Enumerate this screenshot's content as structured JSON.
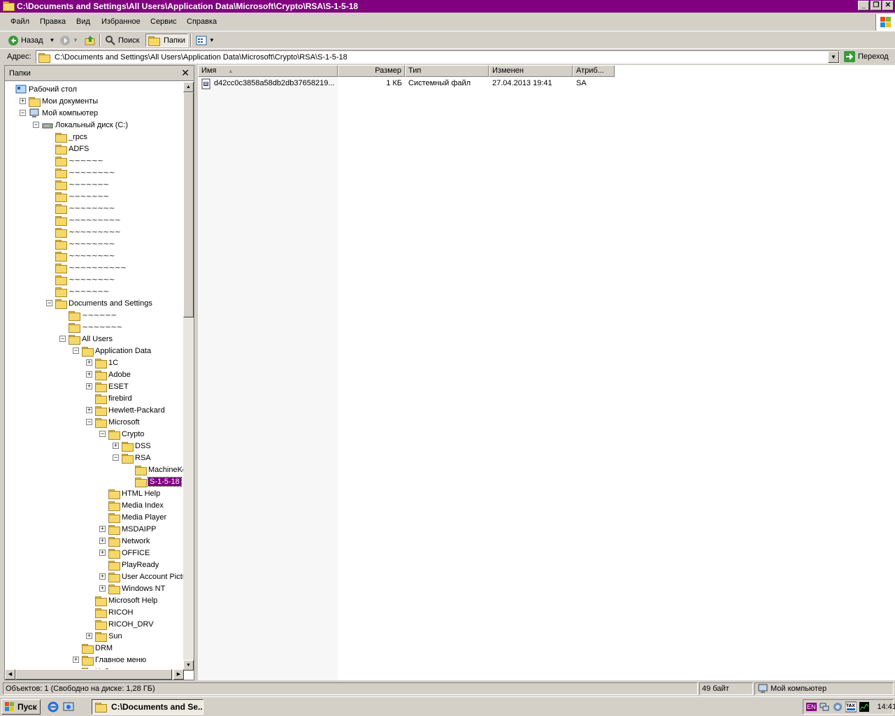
{
  "window": {
    "title": "C:\\Documents and Settings\\All Users\\Application Data\\Microsoft\\Crypto\\RSA\\S-1-5-18",
    "minimize": "_",
    "maximize": "❐",
    "close": "✕"
  },
  "menu": [
    "Файл",
    "Правка",
    "Вид",
    "Избранное",
    "Сервис",
    "Справка"
  ],
  "toolbar": {
    "back": "Назад",
    "search": "Поиск",
    "folders": "Папки"
  },
  "address": {
    "label": "Адрес:",
    "value": "C:\\Documents and Settings\\All Users\\Application Data\\Microsoft\\Crypto\\RSA\\S-1-5-18",
    "go": "Переход"
  },
  "folders_pane": {
    "title": "Папки",
    "close": "✕",
    "tree": [
      {
        "label": "Рабочий стол",
        "exp": ""
      },
      {
        "label": "Мои документы",
        "exp": "+"
      },
      {
        "label": "Мой компьютер",
        "exp": "−"
      },
      {
        "label": "Локальный диск (C:)",
        "exp": "−"
      },
      {
        "label": "_rpcs",
        "exp": ""
      },
      {
        "label": "ADFS",
        "exp": ""
      },
      {
        "label": "~~~~~~",
        "exp": "",
        "scribble": true
      },
      {
        "label": "~~~~~~~~",
        "exp": "",
        "scribble": true
      },
      {
        "label": "~~~~~~~",
        "exp": "",
        "scribble": true
      },
      {
        "label": "~~~~~~~",
        "exp": "",
        "scribble": true
      },
      {
        "label": "~~~~~~~~",
        "exp": "",
        "scribble": true
      },
      {
        "label": "~~~~~~~~~",
        "exp": "",
        "scribble": true
      },
      {
        "label": "~~~~~~~~~",
        "exp": "",
        "scribble": true
      },
      {
        "label": "~~~~~~~~",
        "exp": "",
        "scribble": true
      },
      {
        "label": "~~~~~~~~",
        "exp": "",
        "scribble": true
      },
      {
        "label": "~~~~~~~~~~",
        "exp": "",
        "scribble": true
      },
      {
        "label": "~~~~~~~~",
        "exp": "",
        "scribble": true
      },
      {
        "label": "~~~~~~~",
        "exp": "",
        "scribble": true
      },
      {
        "label": "Documents and Settings",
        "exp": "−"
      },
      {
        "label": "~~~~~~",
        "exp": "",
        "scribble": true
      },
      {
        "label": "~~~~~~~",
        "exp": "",
        "scribble": true
      },
      {
        "label": "All Users",
        "exp": "−"
      },
      {
        "label": "Application Data",
        "exp": "−"
      },
      {
        "label": "1C",
        "exp": "+"
      },
      {
        "label": "Adobe",
        "exp": "+"
      },
      {
        "label": "ESET",
        "exp": "+"
      },
      {
        "label": "firebird",
        "exp": ""
      },
      {
        "label": "Hewlett-Packard",
        "exp": "+"
      },
      {
        "label": "Microsoft",
        "exp": "−"
      },
      {
        "label": "Crypto",
        "exp": "−"
      },
      {
        "label": "DSS",
        "exp": "+"
      },
      {
        "label": "RSA",
        "exp": "−"
      },
      {
        "label": "MachineKeys",
        "exp": ""
      },
      {
        "label": "S-1-5-18",
        "exp": "",
        "selected": true
      },
      {
        "label": "HTML Help",
        "exp": ""
      },
      {
        "label": "Media Index",
        "exp": ""
      },
      {
        "label": "Media Player",
        "exp": ""
      },
      {
        "label": "MSDAIPP",
        "exp": "+"
      },
      {
        "label": "Network",
        "exp": "+"
      },
      {
        "label": "OFFICE",
        "exp": "+"
      },
      {
        "label": "PlayReady",
        "exp": ""
      },
      {
        "label": "User Account Pictures",
        "exp": "+"
      },
      {
        "label": "Windows NT",
        "exp": "+"
      },
      {
        "label": "Microsoft Help",
        "exp": ""
      },
      {
        "label": "RICOH",
        "exp": ""
      },
      {
        "label": "RICOH_DRV",
        "exp": ""
      },
      {
        "label": "Sun",
        "exp": "+"
      },
      {
        "label": "DRM",
        "exp": ""
      },
      {
        "label": "Главное меню",
        "exp": "+"
      },
      {
        "label": "Избранное",
        "exp": ""
      }
    ]
  },
  "columns": {
    "name": "Имя",
    "size": "Размер",
    "type": "Тип",
    "modified": "Изменен",
    "attributes": "Атриб..."
  },
  "files": [
    {
      "name": "d42cc0c3858a58db2db37658219...",
      "size": "1 КБ",
      "type": "Системный файл",
      "modified": "27.04.2013 19:41",
      "attributes": "SA"
    }
  ],
  "status": {
    "objects": "Объектов: 1 (Свободно на диске: 1,28 ГБ)",
    "bytes": "49 байт",
    "location": "Мой компьютер"
  },
  "taskbar": {
    "start": "Пуск",
    "task": "C:\\Documents and Se...",
    "lang": "EN",
    "clock": "14:41"
  }
}
